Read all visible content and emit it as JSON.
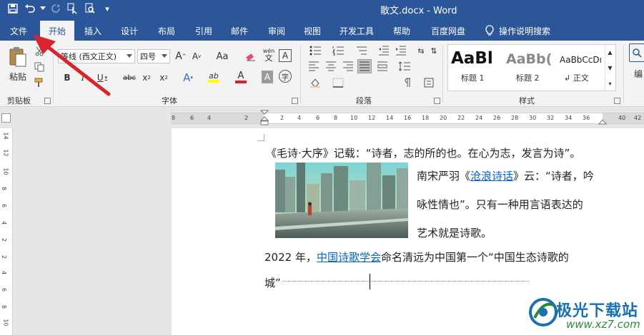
{
  "window": {
    "title": "散文.docx - Word"
  },
  "qat": {
    "more": "▾"
  },
  "tabs": [
    "文件",
    "开始",
    "插入",
    "设计",
    "布局",
    "引用",
    "邮件",
    "审阅",
    "视图",
    "开发工具",
    "帮助",
    "百度网盘"
  ],
  "tell_me": "操作说明搜索",
  "ribbon": {
    "clipboard": {
      "paste": "粘贴",
      "label": "剪贴板"
    },
    "font": {
      "name": "等线 (西文正文)",
      "size": "四号",
      "grow": "A",
      "shrink": "A",
      "case": "Aa",
      "phonetic": "wén",
      "bold": "B",
      "italic": "I",
      "underline": "U",
      "strike": "abc",
      "sub": "x",
      "sup": "x",
      "text_effect": "A",
      "highlight": "ab",
      "font_color": "A",
      "char_shade": "A",
      "enclose": "字",
      "label": "字体"
    },
    "paragraph": {
      "label": "段落"
    },
    "styles": {
      "items": [
        {
          "sample": "AaBl",
          "name": "标题 1"
        },
        {
          "sample": "AaBb(",
          "name": "标题 2"
        },
        {
          "sample": "AaBbCcDı",
          "name": "↲ 正文"
        }
      ],
      "label": "样式"
    },
    "edit": {
      "label": "编"
    }
  },
  "ruler": {
    "ticks": [
      "8",
      "6",
      "4",
      "2",
      "2",
      "4",
      "6",
      "8",
      "10",
      "12",
      "14",
      "16",
      "18",
      "20",
      "22",
      "24",
      "26",
      "28",
      "30",
      "32",
      "34",
      "36",
      "40",
      "42"
    ],
    "vticks": [
      "14",
      "12",
      "10",
      "8",
      "6",
      "4",
      "2",
      "2",
      "4",
      "6",
      "8",
      "10",
      "12",
      "14",
      "16",
      "18"
    ]
  },
  "document": {
    "line1": "《毛诗·大序》记载：“诗者，志的所的也。在心为志，发言为诗”。",
    "line2_prefix": "南宋严羽《",
    "line2_link": "沧浪诗话",
    "line2_suffix": "》云：“诗者，吟",
    "line3": "咏性情也”。只有一种用言语表达的",
    "line4": "艺术就是诗歌。",
    "line5_prefix": "2022 年，",
    "line5_link": "中国诗歌学会",
    "line5_suffix": "命名清远为中国第一个“中国生态诗歌的",
    "line6": "城”"
  },
  "watermark": {
    "brand": "极光下载站",
    "url": "www.xz7.com"
  },
  "colors": {
    "accent": "#2b579a",
    "link": "#0563c1",
    "arrow": "#d9232d"
  }
}
